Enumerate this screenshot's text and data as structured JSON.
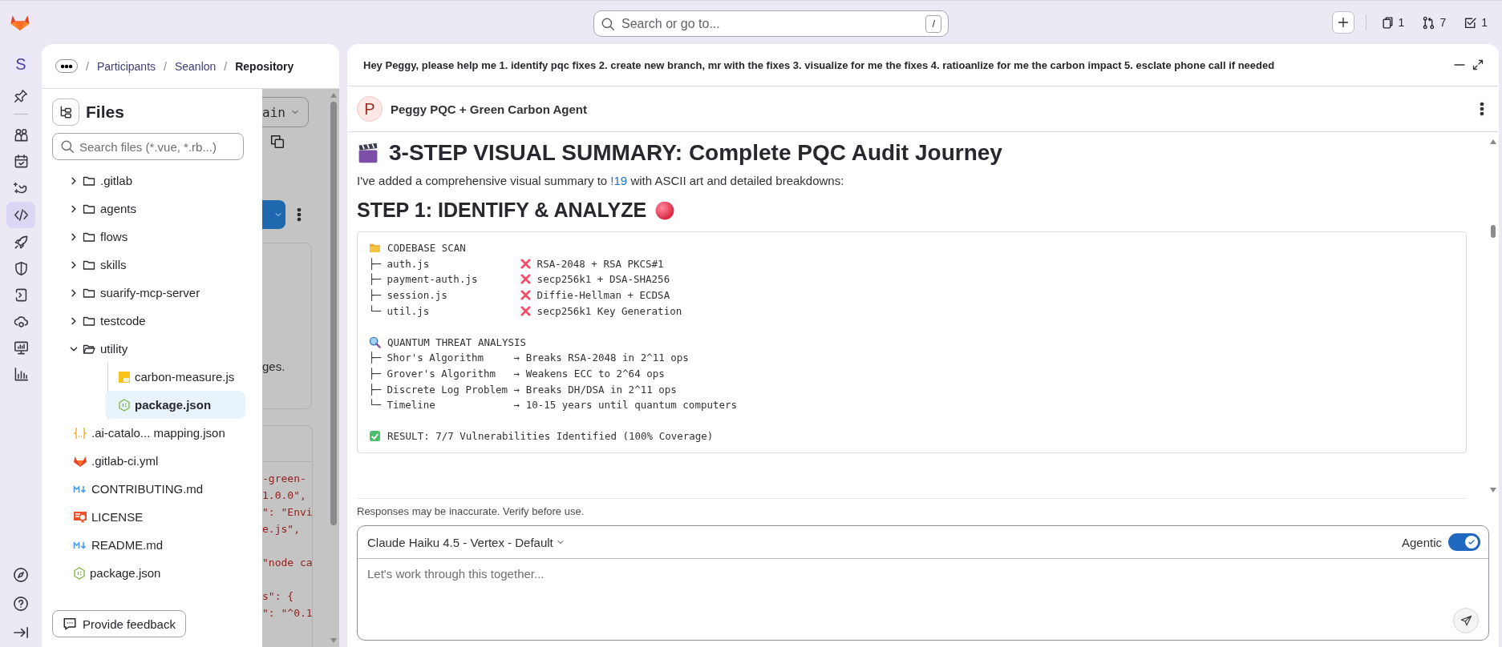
{
  "top_bar": {
    "search": {
      "placeholder": "Search or go to...",
      "shortcut": "/"
    },
    "counters": [
      {
        "count": "1"
      },
      {
        "count": "7"
      },
      {
        "count": "1"
      }
    ]
  },
  "sidebar": {
    "avatar": "S",
    "items": [
      {
        "selected": false
      },
      {
        "selected": false
      },
      {
        "selected": false
      },
      {
        "selected": true
      },
      {
        "selected": false
      },
      {
        "selected": false
      },
      {
        "selected": false
      },
      {
        "selected": false
      },
      {
        "selected": false
      },
      {
        "selected": false
      }
    ]
  },
  "breadcrumbs": [
    {
      "separator": "/",
      "label": "Participants"
    },
    {
      "separator": "/",
      "label": "Seanlon"
    },
    {
      "separator": "/",
      "label": "Repository"
    }
  ],
  "repository_background": {
    "branch": "ain",
    "card_text": "ges.",
    "code_groups": [
      [
        "-green-",
        "1.0.0\",",
        "\": \"Envi",
        "e.js\","
      ],
      [
        "\"node ca"
      ],
      [
        "s\": {",
        "\": \"^0.1"
      ]
    ]
  },
  "files": {
    "title": "Files",
    "search_placeholder": "Search files (*.vue, *.rb...)",
    "tree": [
      {
        "name": ".gitlab",
        "kind": "folder",
        "expanded": false,
        "selected": false
      },
      {
        "name": "agents",
        "kind": "folder",
        "expanded": false,
        "selected": false
      },
      {
        "name": "flows",
        "kind": "folder",
        "expanded": false,
        "selected": false
      },
      {
        "name": "skills",
        "kind": "folder",
        "expanded": false,
        "selected": false
      },
      {
        "name": "suarify-mcp-server",
        "kind": "folder",
        "expanded": false,
        "selected": false
      },
      {
        "name": "testcode",
        "kind": "folder",
        "expanded": false,
        "selected": false
      },
      {
        "name": "utility",
        "kind": "folder",
        "expanded": true,
        "selected": false,
        "children": [
          {
            "name": "carbon-measure.js",
            "kind": "js",
            "selected": false
          },
          {
            "name": "package.json",
            "kind": "node",
            "selected": true
          }
        ]
      },
      {
        "name": ".ai-catalo... mapping.json",
        "kind": "json",
        "selected": false
      },
      {
        "name": ".gitlab-ci.yml",
        "kind": "gitlab",
        "selected": false
      },
      {
        "name": "CONTRIBUTING.md",
        "kind": "markdown",
        "selected": false
      },
      {
        "name": "LICENSE",
        "kind": "license",
        "selected": false
      },
      {
        "name": "README.md",
        "kind": "markdown",
        "selected": false
      },
      {
        "name": "package.json",
        "kind": "node",
        "selected": false
      }
    ],
    "feedback_button": "Provide feedback"
  },
  "chat": {
    "prompt": "Hey Peggy, please help me 1. identify pqc fixes 2. create new branch, mr with the fixes 3. visualize for me the fixes 4. ratioanlize for me the carbon impact 5. esclate phone call if needed",
    "agent": {
      "initial": "P",
      "name": "Peggy PQC + Green Carbon Agent"
    },
    "heading": "3-STEP VISUAL SUMMARY: Complete PQC Audit Journey",
    "intro": {
      "before": "I've added a comprehensive visual summary to ",
      "link": "!19",
      "after": " with ASCII art and detailed breakdowns:"
    },
    "step_heading": "STEP 1: IDENTIFY & ANALYZE",
    "code_lines": [
      {
        "kind": "scan_heading",
        "text": "CODEBASE SCAN"
      },
      {
        "kind": "finding",
        "name": "├─ auth.js",
        "text": "RSA-2048 + RSA PKCS#1"
      },
      {
        "kind": "finding",
        "name": "├─ payment-auth.js",
        "text": "secp256k1 + DSA-SHA256"
      },
      {
        "kind": "finding",
        "name": "├─ session.js",
        "text": "Diffie-Hellman + ECDSA"
      },
      {
        "kind": "finding",
        "name": "└─ util.js",
        "text": "secp256k1 Key Generation"
      },
      {
        "kind": "analysis_heading",
        "text": "QUANTUM THREAT ANALYSIS"
      },
      {
        "kind": "line",
        "text": "├─ Shor's Algorithm     → Breaks RSA-2048 in 2^11 ops"
      },
      {
        "kind": "line",
        "text": "├─ Grover's Algorithm   → Weakens ECC to 2^64 ops"
      },
      {
        "kind": "line",
        "text": "├─ Discrete Log Problem → Breaks DH/DSA in 2^11 ops"
      },
      {
        "kind": "line",
        "text": "└─ Timeline             → 10-15 years until quantum computers"
      },
      {
        "kind": "result",
        "text": "RESULT: 7/7 Vulnerabilities Identified (100% Coverage)"
      }
    ],
    "disclaimer": "Responses may be inaccurate. Verify before use.",
    "composer": {
      "model": "Claude Haiku 4.5 - Vertex - Default",
      "agentic": {
        "label": "Agentic",
        "on": true
      },
      "placeholder": "Let's work through this together..."
    }
  }
}
